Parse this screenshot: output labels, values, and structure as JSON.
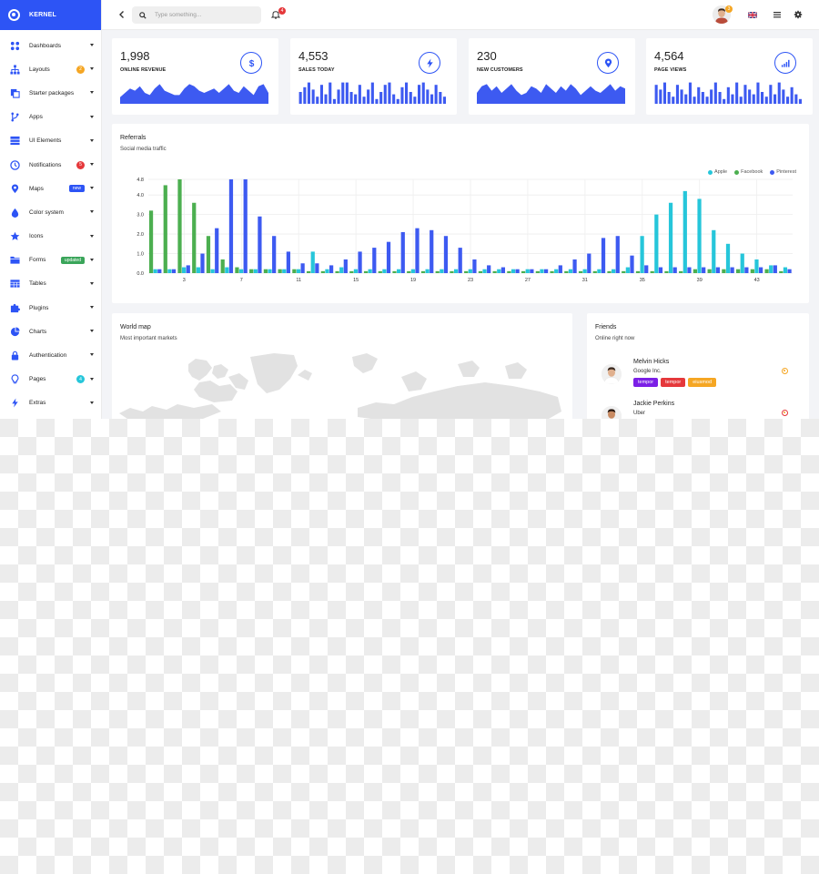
{
  "brand": {
    "name": "KERNEL"
  },
  "sidebar": {
    "items": [
      {
        "label": "Dashboards",
        "icon": "dashboard-icon"
      },
      {
        "label": "Layouts",
        "icon": "sitemap-icon",
        "badge": "2",
        "badge_color": "#f5a623",
        "badge_style": "round"
      },
      {
        "label": "Starter packages",
        "icon": "copy-icon"
      },
      {
        "label": "Apps",
        "icon": "branch-icon"
      },
      {
        "label": "UI Elements",
        "icon": "server-icon"
      },
      {
        "label": "Notifications",
        "icon": "clock-icon",
        "badge": "5",
        "badge_color": "#e5383b",
        "badge_style": "round"
      },
      {
        "label": "Maps",
        "icon": "map-pin-icon",
        "badge": "new",
        "badge_color": "#2d54f5",
        "badge_style": "rect"
      },
      {
        "label": "Color system",
        "icon": "droplet-icon"
      },
      {
        "label": "Icons",
        "icon": "star-icon"
      },
      {
        "label": "Forms",
        "icon": "folder-icon",
        "badge": "updated",
        "badge_color": "#3aa55a",
        "badge_style": "rect"
      },
      {
        "label": "Tables",
        "icon": "table-icon"
      },
      {
        "label": "Plugins",
        "icon": "puzzle-icon"
      },
      {
        "label": "Charts",
        "icon": "pie-chart-icon"
      },
      {
        "label": "Authentication",
        "icon": "lock-icon"
      },
      {
        "label": "Pages",
        "icon": "lightbulb-icon",
        "badge": "4",
        "badge_color": "#26c6da",
        "badge_style": "round"
      },
      {
        "label": "Extras",
        "icon": "bolt-icon"
      }
    ]
  },
  "header": {
    "search_placeholder": "Type something...",
    "notifications_count": "4",
    "user_badge": "3"
  },
  "stats": [
    {
      "value": "1,998",
      "label": "ONLINE REVENUE",
      "icon": "dollar-icon",
      "spark_type": "area"
    },
    {
      "value": "4,553",
      "label": "SALES TODAY",
      "icon": "bolt-icon",
      "spark_type": "bar"
    },
    {
      "value": "230",
      "label": "NEW CUSTOMERS",
      "icon": "map-pin-icon",
      "spark_type": "area"
    },
    {
      "value": "4,564",
      "label": "PAGE VIEWS",
      "icon": "signal-icon",
      "spark_type": "bar"
    }
  ],
  "referrals": {
    "title": "Referrals",
    "subtitle": "Social media traffic"
  },
  "world_map": {
    "title": "World map",
    "subtitle": "Most important markets"
  },
  "friends": {
    "title": "Friends",
    "subtitle": "Online right now",
    "people": [
      {
        "name": "Melvin Hicks",
        "company": "Google Inc.",
        "tags": [
          {
            "label": "tempor",
            "color": "#7b1fe6"
          },
          {
            "label": "tempor",
            "color": "#e5383b"
          },
          {
            "label": "eiusmod",
            "color": "#f5a623"
          }
        ]
      },
      {
        "name": "Jackie Perkins",
        "company": "Uber",
        "tags": []
      }
    ]
  },
  "chart_data": {
    "type": "bar",
    "title": "",
    "xlabel": "",
    "ylabel": "",
    "ylim": [
      0,
      4.8
    ],
    "yticks": [
      0.0,
      1.0,
      2.0,
      3.0,
      4.0,
      4.8
    ],
    "xtick_labels": [
      "3",
      "7",
      "11",
      "15",
      "19",
      "23",
      "27",
      "31",
      "35",
      "39",
      "43"
    ],
    "xtick_positions": [
      3,
      7,
      11,
      15,
      19,
      23,
      27,
      31,
      35,
      39,
      43
    ],
    "x": [
      1,
      2,
      3,
      4,
      5,
      6,
      7,
      8,
      9,
      10,
      11,
      12,
      13,
      14,
      15,
      16,
      17,
      18,
      19,
      20,
      21,
      22,
      23,
      24,
      25,
      26,
      27,
      28,
      29,
      30,
      31,
      32,
      33,
      34,
      35,
      36,
      37,
      38,
      39,
      40,
      41,
      42,
      43,
      44,
      45
    ],
    "legend_position": "top-right",
    "grid": true,
    "series": [
      {
        "name": "Apple",
        "color": "#26c6da",
        "values": [
          0.2,
          0.2,
          0.3,
          0.3,
          0.2,
          0.3,
          0.2,
          0.2,
          0.2,
          0.2,
          0.2,
          1.1,
          0.2,
          0.3,
          0.2,
          0.2,
          0.2,
          0.2,
          0.2,
          0.2,
          0.2,
          0.2,
          0.2,
          0.2,
          0.2,
          0.2,
          0.2,
          0.2,
          0.2,
          0.2,
          0.2,
          0.2,
          0.2,
          0.3,
          1.9,
          3.0,
          3.6,
          4.2,
          3.8,
          2.2,
          1.5,
          1.0,
          0.7,
          0.4,
          0.3
        ]
      },
      {
        "name": "Facebook",
        "color": "#4caf50",
        "values": [
          3.2,
          4.5,
          4.8,
          3.6,
          1.9,
          0.7,
          0.3,
          0.2,
          0.2,
          0.2,
          0.2,
          0.1,
          0.1,
          0.1,
          0.1,
          0.1,
          0.1,
          0.1,
          0.1,
          0.1,
          0.1,
          0.1,
          0.1,
          0.1,
          0.1,
          0.1,
          0.1,
          0.1,
          0.1,
          0.1,
          0.1,
          0.1,
          0.1,
          0.1,
          0.1,
          0.1,
          0.1,
          0.1,
          0.2,
          0.2,
          0.2,
          0.2,
          0.2,
          0.2,
          0.1
        ]
      },
      {
        "name": "Pinterest",
        "color": "#3d5af1",
        "values": [
          0.2,
          0.2,
          0.4,
          1.0,
          2.3,
          4.8,
          4.8,
          2.9,
          1.9,
          1.1,
          0.5,
          0.5,
          0.4,
          0.7,
          1.1,
          1.3,
          1.6,
          2.1,
          2.3,
          2.2,
          1.9,
          1.3,
          0.7,
          0.4,
          0.3,
          0.2,
          0.2,
          0.2,
          0.4,
          0.7,
          1.0,
          1.8,
          1.9,
          0.9,
          0.4,
          0.3,
          0.3,
          0.3,
          0.3,
          0.3,
          0.3,
          0.3,
          0.3,
          0.4,
          0.2
        ]
      }
    ]
  },
  "colors": {
    "primary": "#2d54f5",
    "background": "#f3f4f7"
  }
}
